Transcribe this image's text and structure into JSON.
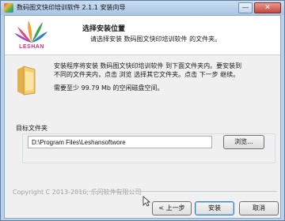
{
  "window": {
    "title": "数码图文快印培训软件 2.1.1 安装向导",
    "minimize_glyph": "—",
    "close_glyph": "✕"
  },
  "header": {
    "title": "选择安装位置",
    "subtitle": "请选择安装 数码图文快印培训软件 的文件夹。",
    "logo_text": "LESHAN"
  },
  "body": {
    "line1": "安装程序将安装 数码图文快印培训软件 到下面文件夹内。要安装到",
    "line2": "不同的文件夹内，点击 浏览 选择其它文件夹。点击 下一步 继续。",
    "space_required": "需要至少 99.79 Mb 的空闲磁盘空间。"
  },
  "target": {
    "label": "目标文件夹",
    "path_value": "D:\\Program Files\\Leshansoftwore",
    "browse_label": "浏览..."
  },
  "footer": {
    "copyright": "Copyright C 2013-2016, 乐闪软件有限公司",
    "back_label": "< 上一步",
    "install_label": "安装",
    "cancel_label": "取消"
  }
}
